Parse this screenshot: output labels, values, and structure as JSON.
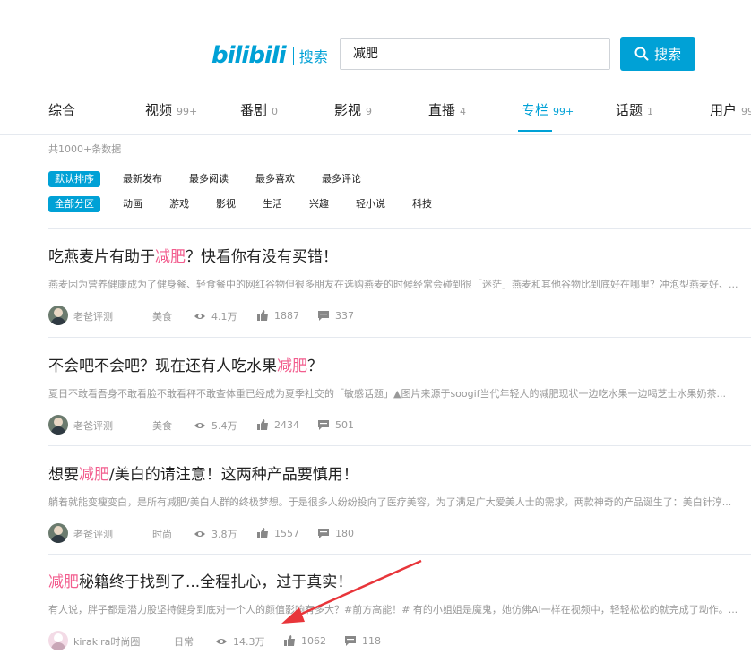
{
  "header": {
    "logo_text": "bilibili",
    "logo_sub": "搜索",
    "search_value": "减肥",
    "search_button": "搜索"
  },
  "tabs": [
    {
      "label": "综合",
      "count": ""
    },
    {
      "label": "视频",
      "count": "99+"
    },
    {
      "label": "番剧",
      "count": "0"
    },
    {
      "label": "影视",
      "count": "9"
    },
    {
      "label": "直播",
      "count": "4"
    },
    {
      "label": "专栏",
      "count": "99+"
    },
    {
      "label": "话题",
      "count": "1"
    },
    {
      "label": "用户",
      "count": "99"
    }
  ],
  "total": "共1000+条数据",
  "sort_filters": [
    "默认排序",
    "最新发布",
    "最多阅读",
    "最多喜欢",
    "最多评论"
  ],
  "category_filters": [
    "全部分区",
    "动画",
    "游戏",
    "影视",
    "生活",
    "兴趣",
    "轻小说",
    "科技"
  ],
  "articles": [
    {
      "title_pre": "吃燕麦片有助于",
      "title_hl": "减肥",
      "title_post": "？快看你有没有买错！",
      "desc": "燕麦因为营养健康成为了健身餐、轻食餐中的网红谷物但很多朋友在选购燕麦的时候经常会碰到很「迷茫」燕麦和其他谷物比到底好在哪里？冲泡型燕麦好、...",
      "author": "老爸评测",
      "category": "美食",
      "views": "4.1万",
      "likes": "1887",
      "comments": "337"
    },
    {
      "title_pre": "不会吧不会吧？现在还有人吃水果",
      "title_hl": "减肥",
      "title_post": "？",
      "desc": "夏日不敢看吾身不敢看脸不敢看秤不敢查体重已经成为夏季社交的「敏感话题」▲图片来源于soogif当代年轻人的减肥现状一边吃水果一边喝芝士水果奶茶...",
      "author": "老爸评测",
      "category": "美食",
      "views": "5.4万",
      "likes": "2434",
      "comments": "501"
    },
    {
      "title_pre": "想要",
      "title_hl": "减肥",
      "title_post": "/美白的请注意！这两种产品要慎用！",
      "desc": "躺着就能变瘦变白，是所有减肥/美白人群的终极梦想。于是很多人纷纷投向了医疗美容，为了满足广大爱美人士的需求，两款神奇的产品诞生了：美白针淳...",
      "author": "老爸评测",
      "category": "时尚",
      "views": "3.8万",
      "likes": "1557",
      "comments": "180"
    },
    {
      "title_pre": "",
      "title_hl": "减肥",
      "title_post": "秘籍终于找到了...全程扎心，过于真实！",
      "desc": "有人说，胖子都是潜力股坚持健身到底对一个人的颜值影响有多大？#前方高能！# 有的小姐姐是魔鬼，她仿佛AI一样在视频中，轻轻松松的就完成了动作。...",
      "author": "kirakira时尚圈",
      "category": "日常",
      "views": "14.3万",
      "likes": "1062",
      "comments": "118"
    }
  ],
  "colors": {
    "accent": "#00a1d6",
    "highlight": "#f25d8e",
    "arrow": "#e8353a"
  }
}
